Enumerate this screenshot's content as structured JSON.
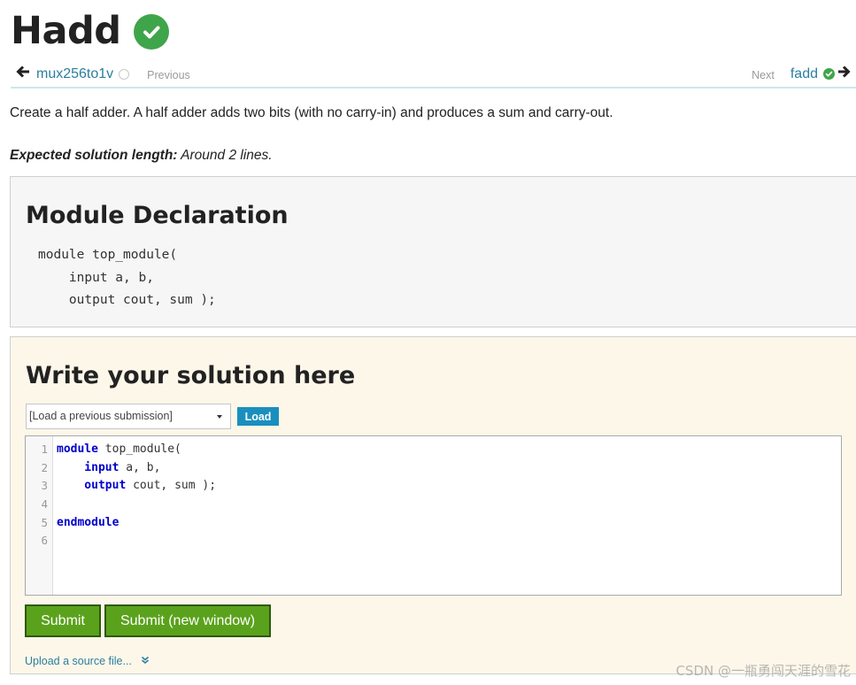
{
  "page": {
    "title": "Hadd",
    "description": "Create a half adder. A half adder adds two bits (with no carry-in) and produces a sum and carry-out.",
    "expected_label": "Expected solution length:",
    "expected_value": " Around 2 lines."
  },
  "nav": {
    "prev_link": "mux256to1v",
    "prev_label": "Previous",
    "next_label": "Next",
    "next_link": "fadd"
  },
  "declaration": {
    "heading": "Module Declaration",
    "code": "module top_module(\n    input a, b,\n    output cout, sum );"
  },
  "solution": {
    "heading": "Write your solution here",
    "load_select_value": "[Load a previous submission]",
    "load_button": "Load",
    "line_numbers": [
      "1",
      "2",
      "3",
      "4",
      "5",
      "6"
    ],
    "code_lines": [
      {
        "kw": "module",
        "rest": " top_module("
      },
      {
        "kw": "    input",
        "rest": " a, b,"
      },
      {
        "kw": "    output",
        "rest": " cout, sum );"
      },
      {
        "kw": "",
        "rest": ""
      },
      {
        "kw": "endmodule",
        "rest": ""
      },
      {
        "kw": "",
        "rest": ""
      }
    ],
    "submit_label": "Submit",
    "submit_new_window_label": "Submit (new window)",
    "upload_label": "Upload a source file..."
  },
  "watermark": "CSDN @一瓶勇闯天涯的雪花",
  "colors": {
    "accent_green": "#3fa54a",
    "submit_green": "#5aa21c",
    "link_teal": "#2a7f9e",
    "load_blue": "#1a8fbe",
    "solution_bg": "#fdf7ea"
  },
  "icons": {
    "title_badge": "check-circle-icon",
    "prev_arrow": "arrow-left-icon",
    "prev_status": "empty-circle-icon",
    "next_status": "check-circle-icon",
    "next_arrow": "arrow-right-icon",
    "select_caret": "caret-down-icon",
    "upload_toggle": "double-chevron-down-icon"
  }
}
